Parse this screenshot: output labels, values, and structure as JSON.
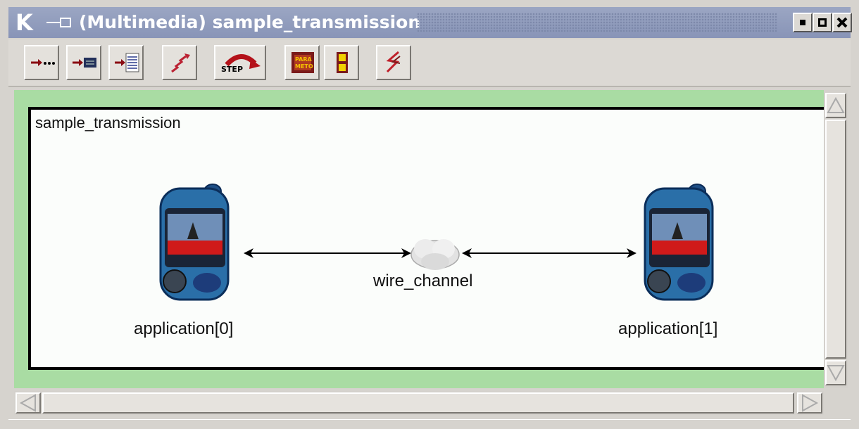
{
  "window": {
    "title": "(Multimedia) sample_transmission",
    "app_icon": "k-icon",
    "controls": [
      "minimize-icon",
      "maximize-icon",
      "close-icon"
    ]
  },
  "toolbar": {
    "buttons": [
      {
        "icon": "run-arrow-dots-icon"
      },
      {
        "icon": "run-arrow-box-icon"
      },
      {
        "icon": "run-arrow-list-icon"
      },
      {
        "icon": "stairs-icon"
      },
      {
        "icon": "step-icon",
        "label": "STEP"
      },
      {
        "icon": "parameters-icon",
        "label": "PARA METO"
      },
      {
        "icon": "split-icon"
      },
      {
        "icon": "lightning-icon"
      }
    ]
  },
  "diagram": {
    "title": "sample_transmission",
    "nodes": [
      {
        "label": "application[0]",
        "icon": "mobile-phone-icon"
      },
      {
        "label": "wire_channel",
        "icon": "cloud-icon"
      },
      {
        "label": "application[1]",
        "icon": "mobile-phone-icon"
      }
    ]
  },
  "colors": {
    "titlebar": "#8894b7",
    "canvas_border": "#a9dca3",
    "phone_body": "#2a6fa8",
    "arrow": "#000000"
  }
}
